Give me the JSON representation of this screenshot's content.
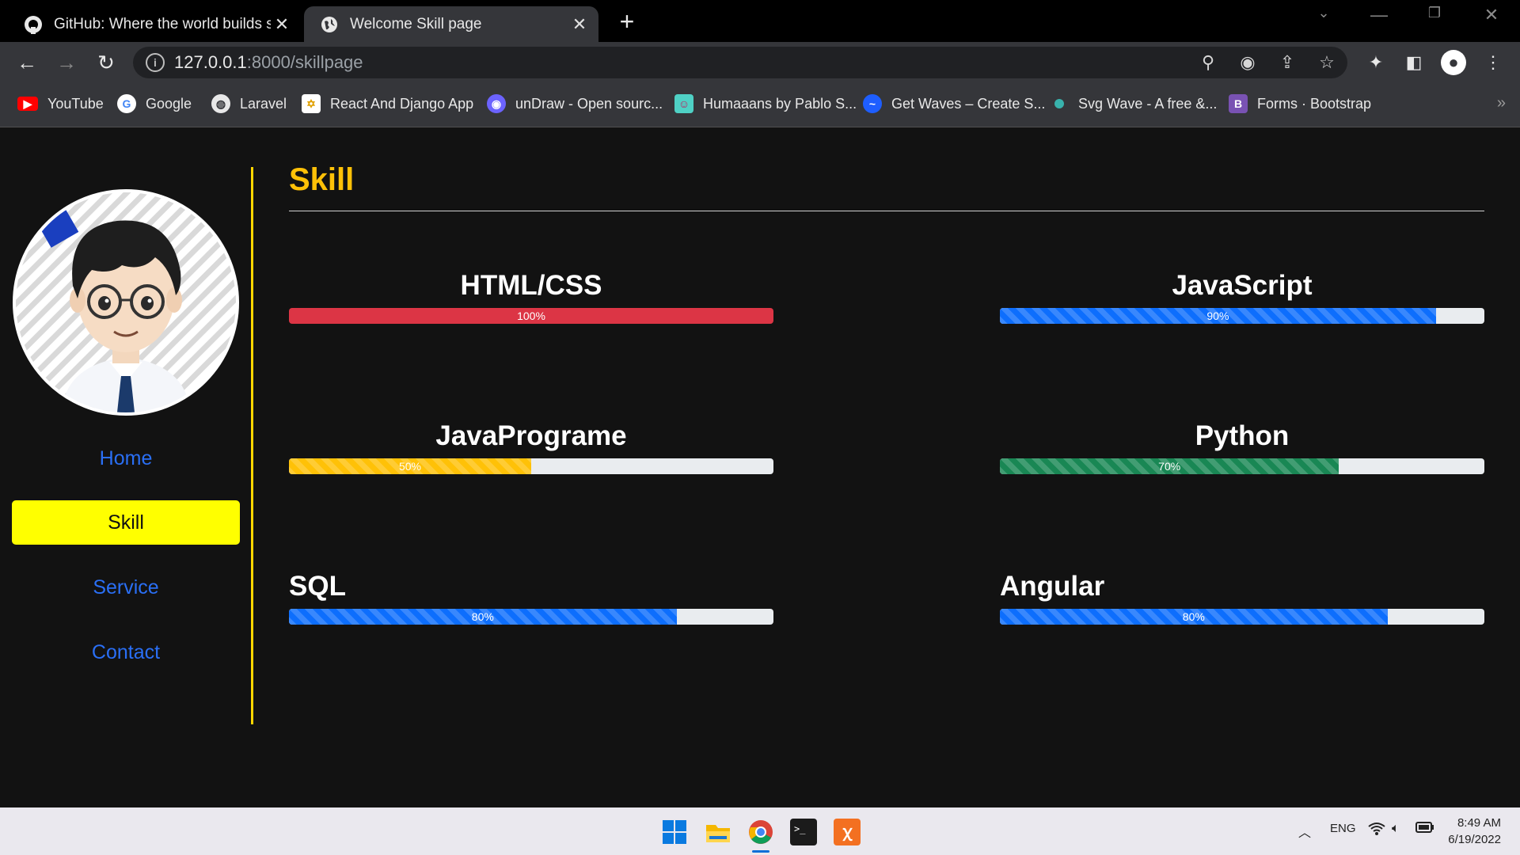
{
  "browser": {
    "tabs": [
      {
        "title": "GitHub: Where the world builds soft",
        "icon": "github-icon",
        "active": false
      },
      {
        "title": "Welcome Skill page",
        "icon": "globe-icon",
        "active": true
      }
    ],
    "url_host": "127.0.0.1",
    "url_rest": ":8000/skillpage",
    "bookmarks": [
      {
        "label": "YouTube",
        "icon": "youtube-icon",
        "color": "#ff0000"
      },
      {
        "label": "Google",
        "icon": "google-icon",
        "color": "#4285f4"
      },
      {
        "label": "Laravel",
        "icon": "globe-icon",
        "color": "#e8e8e8"
      },
      {
        "label": "React And Django App",
        "icon": "react-django-icon",
        "color": "#f4b400"
      },
      {
        "label": "unDraw - Open sourc...",
        "icon": "undraw-icon",
        "color": "#6c63ff"
      },
      {
        "label": "Humaaans by Pablo S...",
        "icon": "humaaans-icon",
        "color": "#4fd1c5"
      },
      {
        "label": "Get Waves – Create S...",
        "icon": "waves-icon",
        "color": "#1e5eff"
      },
      {
        "label": "Svg Wave - A free &...",
        "icon": "svgwave-icon",
        "color": "#38b2ac"
      },
      {
        "label": "Forms · Bootstrap",
        "icon": "bootstrap-icon",
        "color": "#7952b3"
      }
    ]
  },
  "sidebar": {
    "items": [
      {
        "label": "Home",
        "active": false
      },
      {
        "label": "Skill",
        "active": true
      },
      {
        "label": "Service",
        "active": false
      },
      {
        "label": "Contact",
        "active": false
      }
    ]
  },
  "main": {
    "title": "Skill",
    "skills": [
      {
        "name": "HTML/CSS",
        "percent": 100,
        "label": "100%",
        "color": "#dc3545",
        "striped": false
      },
      {
        "name": "JavaScript",
        "percent": 90,
        "label": "90%",
        "color": "#0d6efd",
        "striped": true
      },
      {
        "name": "JavaPrograme",
        "percent": 50,
        "label": "50%",
        "color": "#ffc107",
        "striped": true
      },
      {
        "name": "Python",
        "percent": 70,
        "label": "70%",
        "color": "#198754",
        "striped": true
      },
      {
        "name": "SQL",
        "percent": 80,
        "label": "80%",
        "color": "#0d6efd",
        "striped": true
      },
      {
        "name": "Angular",
        "percent": 80,
        "label": "80%",
        "color": "#0d6efd",
        "striped": true
      }
    ]
  },
  "taskbar": {
    "lang": "ENG",
    "time": "8:49 AM",
    "date": "6/19/2022"
  }
}
